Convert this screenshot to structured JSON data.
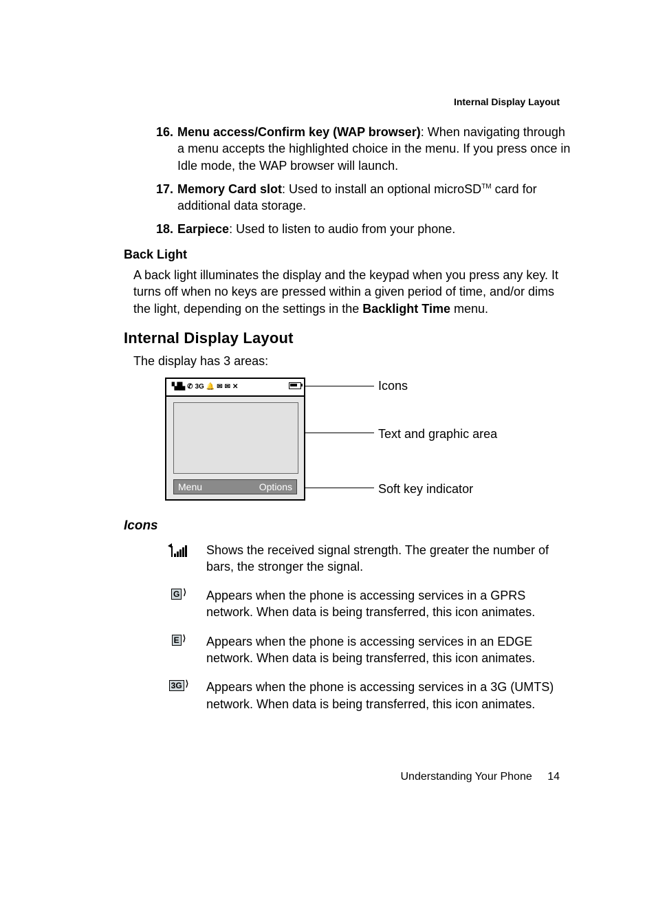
{
  "running_head": "Internal Display Layout",
  "list": [
    {
      "num": "16.",
      "term": "Menu access/Confirm key (WAP browser)",
      "desc": ": When navigating through a menu accepts the highlighted choice in the menu. If you press once in Idle mode, the WAP browser will launch."
    },
    {
      "num": "17.",
      "term": "Memory Card slot",
      "desc_pre": ": Used to install an optional microSD",
      "tm": "TM",
      "desc_post": " card for additional data storage."
    },
    {
      "num": "18.",
      "term": "Earpiece",
      "desc": ": Used to listen to audio from your phone."
    }
  ],
  "backlight": {
    "heading": "Back Light",
    "para_pre": "A back light illuminates the display and the keypad when you press any key. It turns off when no keys are pressed within a given period of time, and/or dims the light, depending on the settings in the ",
    "bold": "Backlight Time",
    "para_post": " menu."
  },
  "section_heading": "Internal Display Layout",
  "section_intro": "The display has 3 areas:",
  "diagram": {
    "softkey_left": "Menu",
    "softkey_right": "Options",
    "callout_icons": "Icons",
    "callout_text": "Text and graphic area",
    "callout_soft": "Soft key indicator"
  },
  "icons_heading": "Icons",
  "icons_defs": [
    {
      "icon": "signal-strength-icon",
      "text": "Shows the received signal strength. The greater the number of bars, the stronger the signal."
    },
    {
      "icon": "gprs-icon",
      "letter": "G",
      "text": "Appears when the phone is accessing services in a GPRS network. When data is being transferred, this icon animates."
    },
    {
      "icon": "edge-icon",
      "letter": "E",
      "text": "Appears when the phone is accessing services in an EDGE network. When data is being transferred, this icon animates."
    },
    {
      "icon": "3g-icon",
      "letter": "3G",
      "text": "Appears when the phone is accessing services in a 3G (UMTS) network.  When data is being transferred, this icon animates."
    }
  ],
  "footer": {
    "chapter": "Understanding Your Phone",
    "page": "14"
  }
}
